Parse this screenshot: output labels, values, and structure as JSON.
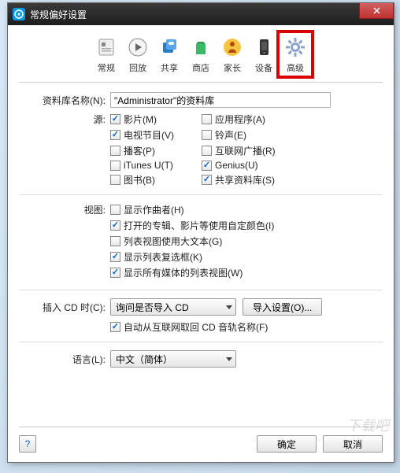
{
  "titlebar": {
    "title": "常规偏好设置"
  },
  "toolbar": {
    "items": [
      {
        "label": "常规"
      },
      {
        "label": "回放"
      },
      {
        "label": "共享"
      },
      {
        "label": "商店"
      },
      {
        "label": "家长"
      },
      {
        "label": "设备"
      },
      {
        "label": "高级"
      }
    ]
  },
  "library": {
    "label": "资料库名称(N):",
    "value": "\"Administrator\"的资料库"
  },
  "source": {
    "label": "源:",
    "items": [
      {
        "label": "影片(M)",
        "checked": true
      },
      {
        "label": "应用程序(A)",
        "checked": false
      },
      {
        "label": "电视节目(V)",
        "checked": true
      },
      {
        "label": "铃声(E)",
        "checked": false
      },
      {
        "label": "播客(P)",
        "checked": false
      },
      {
        "label": "互联网广播(R)",
        "checked": false
      },
      {
        "label": "iTunes U(T)",
        "checked": false
      },
      {
        "label": "Genius(U)",
        "checked": true
      },
      {
        "label": "图书(B)",
        "checked": false
      },
      {
        "label": "共享资料库(S)",
        "checked": true
      }
    ]
  },
  "view": {
    "label": "视图:",
    "items": [
      {
        "label": "显示作曲者(H)",
        "checked": false
      },
      {
        "label": "打开的专辑、影片等使用自定颜色(I)",
        "checked": true
      },
      {
        "label": "列表视图使用大文本(G)",
        "checked": false
      },
      {
        "label": "显示列表复选框(K)",
        "checked": true
      },
      {
        "label": "显示所有媒体的列表视图(W)",
        "checked": true
      }
    ]
  },
  "cd": {
    "label": "插入 CD 时(C):",
    "select_value": "询问是否导入 CD",
    "import_button": "导入设置(O)...",
    "auto_fetch": {
      "label": "自动从互联网取回 CD 音轨名称(F)",
      "checked": true
    }
  },
  "language": {
    "label": "语言(L):",
    "value": "中文（简体）"
  },
  "footer": {
    "help": "?",
    "ok": "确定",
    "cancel": "取消"
  },
  "watermark": "下载吧"
}
